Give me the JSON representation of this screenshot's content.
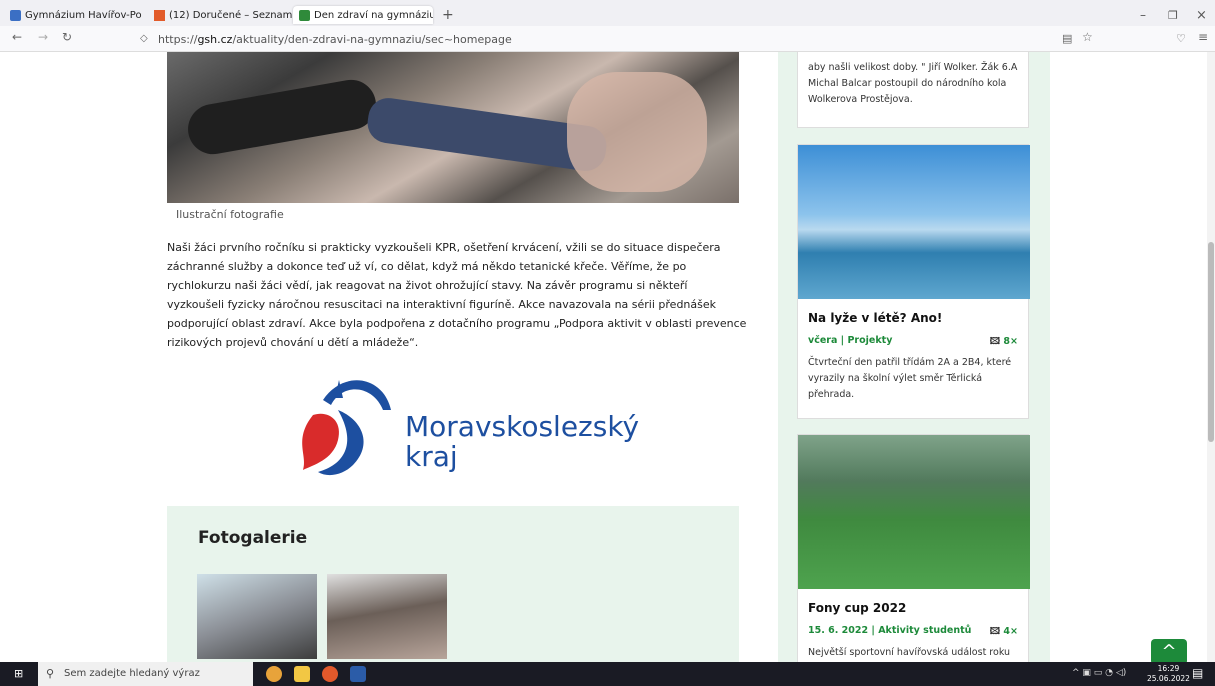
{
  "browser": {
    "tabs": [
      {
        "label": "Gymnázium Havířov-Po",
        "close": "×",
        "color": "#3b6fc4"
      },
      {
        "label": "(12) Doručené – Seznam",
        "close": "×",
        "color": "#e25b2a"
      },
      {
        "label": "Den zdraví na gymnáziu",
        "close": "×",
        "color": "#2f8a3a"
      }
    ],
    "new_tab": "+",
    "url_prefix": "https://",
    "url_domain": "gsh.cz",
    "url_path": "/aktuality/den-zdravi-na-gymnaziu/sec~homepage",
    "win_min": "–",
    "win_max": "❐",
    "win_close": "×"
  },
  "article": {
    "caption": "Ilustrační fotografie",
    "body": "Naši žáci prvního ročníku si prakticky vyzkoušeli KPR, ošetření krvácení, vžili se do situace dispečera záchranné služby a dokonce teď už ví, co dělat, když má někdo tetanické křeče.  Věříme, že po rychlokurzu naši žáci vědí, jak reagovat na život ohrožující stavy.  Na závěr programu si někteří vyzkoušeli fyzicky náročnou resuscitaci na interaktivní figuríně.  Akce navazovala na sérii přednášek podporující oblast zdraví. Akce byla podpořena z dotačního programu „Podpora aktivit v oblasti prevence rizikových projevů chování u dětí a mládeže“.",
    "logo_line1": "Moravskoslezský",
    "logo_line2": "kraj",
    "gallery_title": "Fotogalerie"
  },
  "sidebar": {
    "prev_excerpt": "aby našli velikost doby. \" Jiří Wolker. Žák 6.A Michal Balcar postoupil do národního kola Wolkerova Prostějova.",
    "cards": [
      {
        "title": "Na lyže v létě? Ano!",
        "date": "včera",
        "category": "Projekty",
        "photos": "8×",
        "excerpt": "Čtvrteční den patřil třídám 2A a 2B4, které vyrazily na školní výlet směr Těrlická přehrada."
      },
      {
        "title": "Fony cup 2022",
        "date": "15. 6. 2022",
        "category": "Aktivity studentů",
        "photos": "4×",
        "excerpt": "Největší sportovní havířovská událost roku"
      }
    ]
  },
  "taskbar": {
    "search_placeholder": "Sem zadejte hledaný výraz",
    "time": "16:29",
    "date": "25.06.2022"
  }
}
